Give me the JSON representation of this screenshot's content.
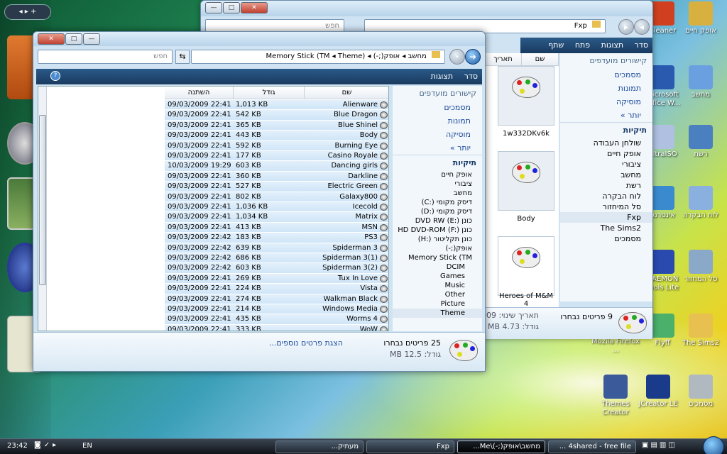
{
  "desktop": {
    "icons": [
      {
        "label": "Cleaner"
      },
      {
        "label": "אופק חיים"
      },
      {
        "label": "Microsoft Office W..."
      },
      {
        "label": "מחשב"
      },
      {
        "label": "UltraISO"
      },
      {
        "label": "רשת"
      },
      {
        "label": "אינטרנט"
      },
      {
        "label": "לוח הבקרה"
      },
      {
        "label": "DAEMON Tools Lite"
      },
      {
        "label": "סל המחזור"
      },
      {
        "label": "Flyff"
      },
      {
        "label": "The Sims2"
      },
      {
        "label": "Mozila Firefox ..."
      },
      {
        "label": "Themes Creator"
      },
      {
        "label": "JCreator LE"
      },
      {
        "label": "מסמכים"
      }
    ]
  },
  "back_window": {
    "address": "Fxp",
    "search_placeholder": "חפש",
    "toolbar": [
      "סדר",
      "תצוגות",
      "פתח",
      "שתף"
    ],
    "favorites_header": "קישורים מועדפים",
    "favorites": [
      "מסמכים",
      "תמונות",
      "מוסיקה"
    ],
    "more": "יותר",
    "folders_header": "תיקיות",
    "tree": [
      "שולחן העבודה",
      "אופק חיים",
      "ציבורי",
      "מחשב",
      "רשת",
      "לוח הבקרה",
      "סל המיחזור",
      "Fxp",
      "The Sims2",
      "מסמכים"
    ],
    "columns": [
      "שם",
      "תאריך"
    ],
    "tiles": [
      {
        "name": "1w332DKv6k"
      },
      {
        "name": "Body"
      },
      {
        "name": "Heroes of M&M 4"
      }
    ],
    "details_date_label": "תאריך שינוי:",
    "details_date": "09/03/2009",
    "details_size_label": "גודל:",
    "details_size": "4.73 MB",
    "details_count": "9 פריטים נבחרו"
  },
  "front_window": {
    "breadcrumb": [
      "מחשב",
      "אופק(;-)",
      "(Memory Stick (TM",
      "Theme"
    ],
    "search_placeholder": "חפש",
    "toolbar": [
      "סדר",
      "תצוגות"
    ],
    "favorites_header": "קישורים מועדפים",
    "favorites": [
      "מסמכים",
      "תמונות",
      "מוסיקה"
    ],
    "more": "יותר",
    "folders_header": "תיקיות",
    "tree": [
      "אופק חיים",
      "ציבורי",
      "מחשב",
      "דיסק מקומי (:C)",
      "דיסק מקומי (:D)",
      "כונן DVD RW (E:)",
      "כונן HD DVD-ROM (F:)",
      "כונן תקליטור (:H)",
      "אופק(;-)",
      "Memory Stick (TM",
      "DCIM",
      "Games",
      "Music",
      "Other",
      "Picture",
      "Theme"
    ],
    "columns": {
      "name": "שם",
      "size": "גודל",
      "date": "השתנה"
    },
    "files": [
      {
        "name": "Alienware",
        "size": "1,013 KB",
        "date": "09/03/2009 22:41"
      },
      {
        "name": "Blue Dragon",
        "size": "542 KB",
        "date": "09/03/2009 22:41"
      },
      {
        "name": "Blue Shinel",
        "size": "365 KB",
        "date": "09/03/2009 22:41"
      },
      {
        "name": "Body",
        "size": "443 KB",
        "date": "09/03/2009 22:41"
      },
      {
        "name": "Burning Eye",
        "size": "592 KB",
        "date": "09/03/2009 22:41"
      },
      {
        "name": "Casino Royale",
        "size": "177 KB",
        "date": "09/03/2009 22:41"
      },
      {
        "name": "Dancing girls",
        "size": "603 KB",
        "date": "10/03/2009 19:29"
      },
      {
        "name": "Darkline",
        "size": "360 KB",
        "date": "09/03/2009 22:41"
      },
      {
        "name": "Electric Green",
        "size": "527 KB",
        "date": "09/03/2009 22:41"
      },
      {
        "name": "Galaxy800",
        "size": "802 KB",
        "date": "09/03/2009 22:41"
      },
      {
        "name": "Icecold",
        "size": "1,036 KB",
        "date": "09/03/2009 22:41"
      },
      {
        "name": "Matrix",
        "size": "1,034 KB",
        "date": "09/03/2009 22:41"
      },
      {
        "name": "MSN",
        "size": "413 KB",
        "date": "09/03/2009 22:41"
      },
      {
        "name": "PS3",
        "size": "183 KB",
        "date": "09/03/2009 22:42"
      },
      {
        "name": "Spiderman 3",
        "size": "639 KB",
        "date": "09/03/2009 22:42"
      },
      {
        "name": "Spiderman 3(1)",
        "size": "686 KB",
        "date": "09/03/2009 22:42"
      },
      {
        "name": "Spiderman 3(2)",
        "size": "603 KB",
        "date": "09/03/2009 22:42"
      },
      {
        "name": "Tux In Love",
        "size": "269 KB",
        "date": "09/03/2009 22:41"
      },
      {
        "name": "Vista",
        "size": "224 KB",
        "date": "09/03/2009 22:41"
      },
      {
        "name": "Walkman Black",
        "size": "274 KB",
        "date": "09/03/2009 22:41"
      },
      {
        "name": "Windows Media",
        "size": "214 KB",
        "date": "09/03/2009 22:41"
      },
      {
        "name": "Worms 4",
        "size": "435 KB",
        "date": "09/03/2009 22:41"
      },
      {
        "name": "WoW",
        "size": "333 KB",
        "date": "09/03/2009 22:41"
      }
    ],
    "details_count": "25 פריטים נבחרו",
    "details_size_label": "גודל:",
    "details_size": "12.5 MB",
    "details_more": "הצגת פרטים נוספים..."
  },
  "taskbar": {
    "clock": "23:42",
    "language": "EN",
    "buttons": [
      {
        "label": "4shared - free file ..."
      },
      {
        "label": "מחשב\\אופק(;-)\\Me..."
      },
      {
        "label": "Fxp"
      },
      {
        "label": "מעתיק..."
      }
    ]
  }
}
